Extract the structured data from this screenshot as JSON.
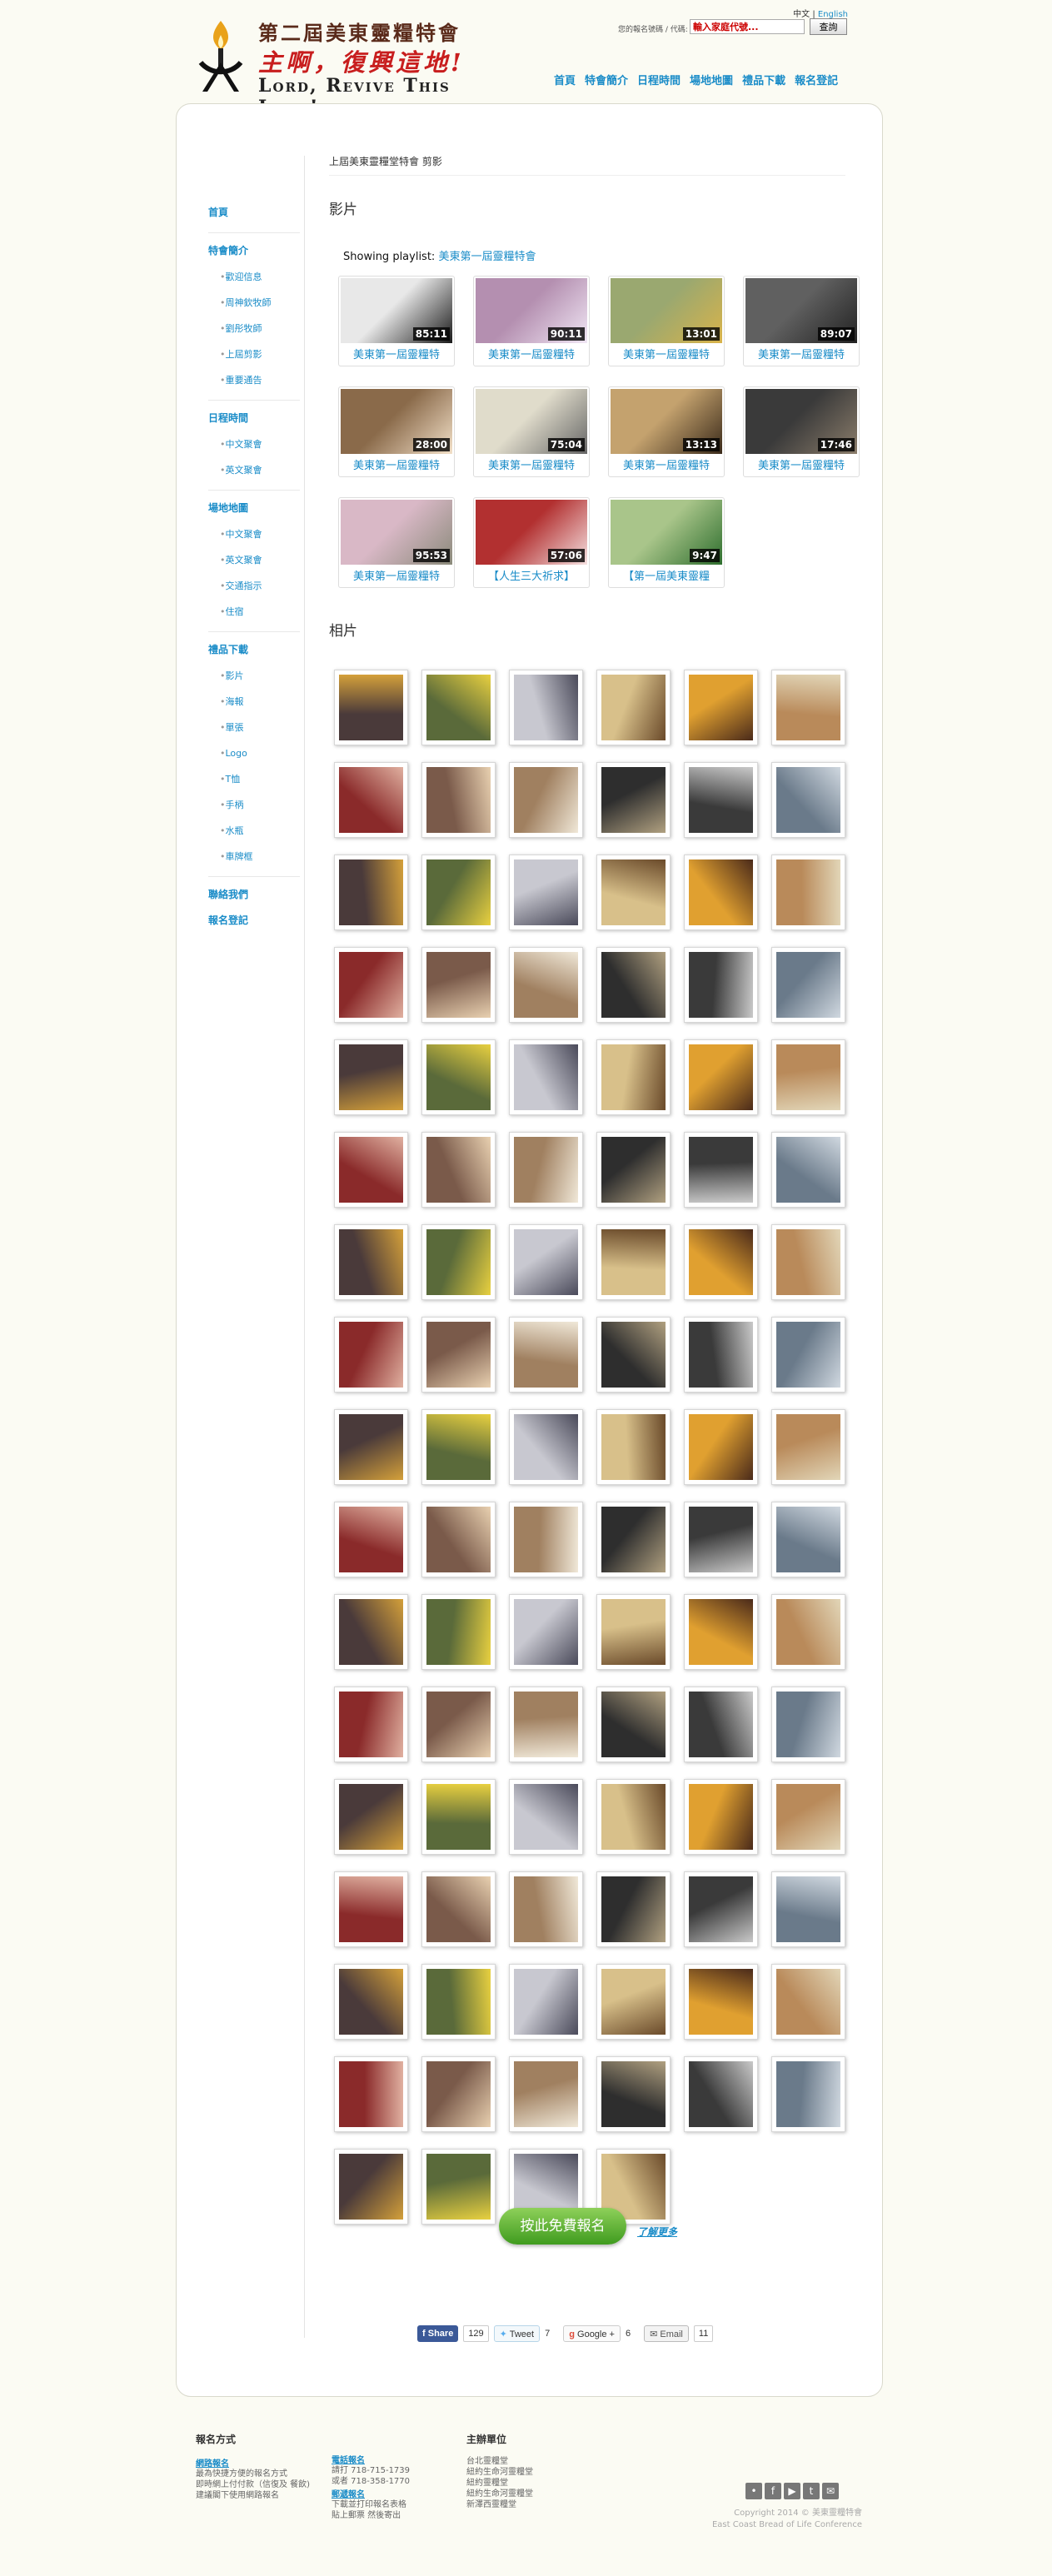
{
  "header": {
    "logo_line1": "第二屆美東靈糧特會",
    "logo_line2": "主啊，復興這地!",
    "logo_line3": "Lord, Revive This Land!",
    "lang_zh": "中文",
    "lang_sep": "|",
    "lang_en": "English",
    "search_label": "您的報名號碼 / 代碼:",
    "search_placeholder": "輸入家庭代號...",
    "search_button": "查詢",
    "nav": [
      "首頁",
      "特會簡介",
      "日程時間",
      "場地地圖",
      "禮品下載",
      "報名登記"
    ]
  },
  "sidebar": {
    "groups": [
      {
        "top": [
          "首頁"
        ]
      },
      {
        "top": [
          "特會簡介"
        ],
        "subs": [
          "歡迎信息",
          "周神欽牧師",
          "劉彤牧師",
          "上屆剪影",
          "重要通告"
        ]
      },
      {
        "top": [
          "日程時間"
        ],
        "subs": [
          "中文聚會",
          "英文聚會"
        ]
      },
      {
        "top": [
          "場地地圖"
        ],
        "subs": [
          "中文聚會",
          "英文聚會",
          "交通指示",
          "住宿"
        ]
      },
      {
        "top": [
          "禮品下載"
        ],
        "subs": [
          "影片",
          "海報",
          "單張",
          "Logo",
          "T恤",
          "手柄",
          "水瓶",
          "車牌框"
        ]
      },
      {
        "top": [
          "聯絡我們",
          "報名登記"
        ]
      }
    ]
  },
  "main": {
    "page_title": "上屆美東靈糧堂特會 剪影",
    "videos_heading": "影片",
    "playlist_prefix": "Showing playlist:",
    "playlist_name": "美東第一屆靈糧特會",
    "videos": [
      {
        "title": "美東第一屆靈糧特",
        "duration": "85:11"
      },
      {
        "title": "美東第一屆靈糧特",
        "duration": "90:11"
      },
      {
        "title": "美東第一屆靈糧特",
        "duration": "13:01"
      },
      {
        "title": "美東第一屆靈糧特",
        "duration": "89:07"
      },
      {
        "title": "美東第一屆靈糧特",
        "duration": "28:00"
      },
      {
        "title": "美東第一屆靈糧特",
        "duration": "75:04"
      },
      {
        "title": "美東第一屆靈糧特",
        "duration": "13:13"
      },
      {
        "title": "美東第一屆靈糧特",
        "duration": "17:46"
      },
      {
        "title": "美東第一屆靈糧特",
        "duration": "95:53"
      },
      {
        "title": "【人生三大祈求】",
        "duration": "57:06"
      },
      {
        "title": "【第一屆美東靈糧",
        "duration": "9:47"
      }
    ],
    "photos_heading": "相片",
    "photo_count": 100,
    "cta_label": "按此免費報名",
    "learn_more": "了解更多",
    "share": {
      "fb_label": "Share",
      "fb_count": "129",
      "tw_label": "Tweet",
      "tw_count": "7",
      "gp_label": "Google +",
      "gp_count": "6",
      "em_label": "Email",
      "em_count": "11"
    }
  },
  "footer": {
    "col1_heading": "報名方式",
    "col1_link1": "網路報名",
    "col1_text": [
      "最為快捷方便的報名方式",
      "即時網上付付款（信復及 餐飲)",
      "建議閣下使用網路報名"
    ],
    "col2_link1": "電話報名",
    "col2_phone1": "請打 718-715-1739",
    "col2_phone2": "或者 718-358-1770",
    "col2_link2": "郵遞報名",
    "col2_text": [
      "下載並打印報名表格",
      "貼上郵票 然後寄出"
    ],
    "col3_heading": "主辦單位",
    "col3_items": [
      "台北靈糧堂",
      "紐約生命河靈糧堂",
      "紐約靈糧堂",
      "紐約生命河靈糧堂",
      "新澤西靈糧堂"
    ],
    "copyright": "Copyright 2014 © 美東靈糧特會",
    "copyright2": "East Coast Bread of Life Conference"
  },
  "colors": {
    "link": "#1a8cc8",
    "cta_green": "#4ea82a",
    "brand_red": "#c81e1e"
  }
}
